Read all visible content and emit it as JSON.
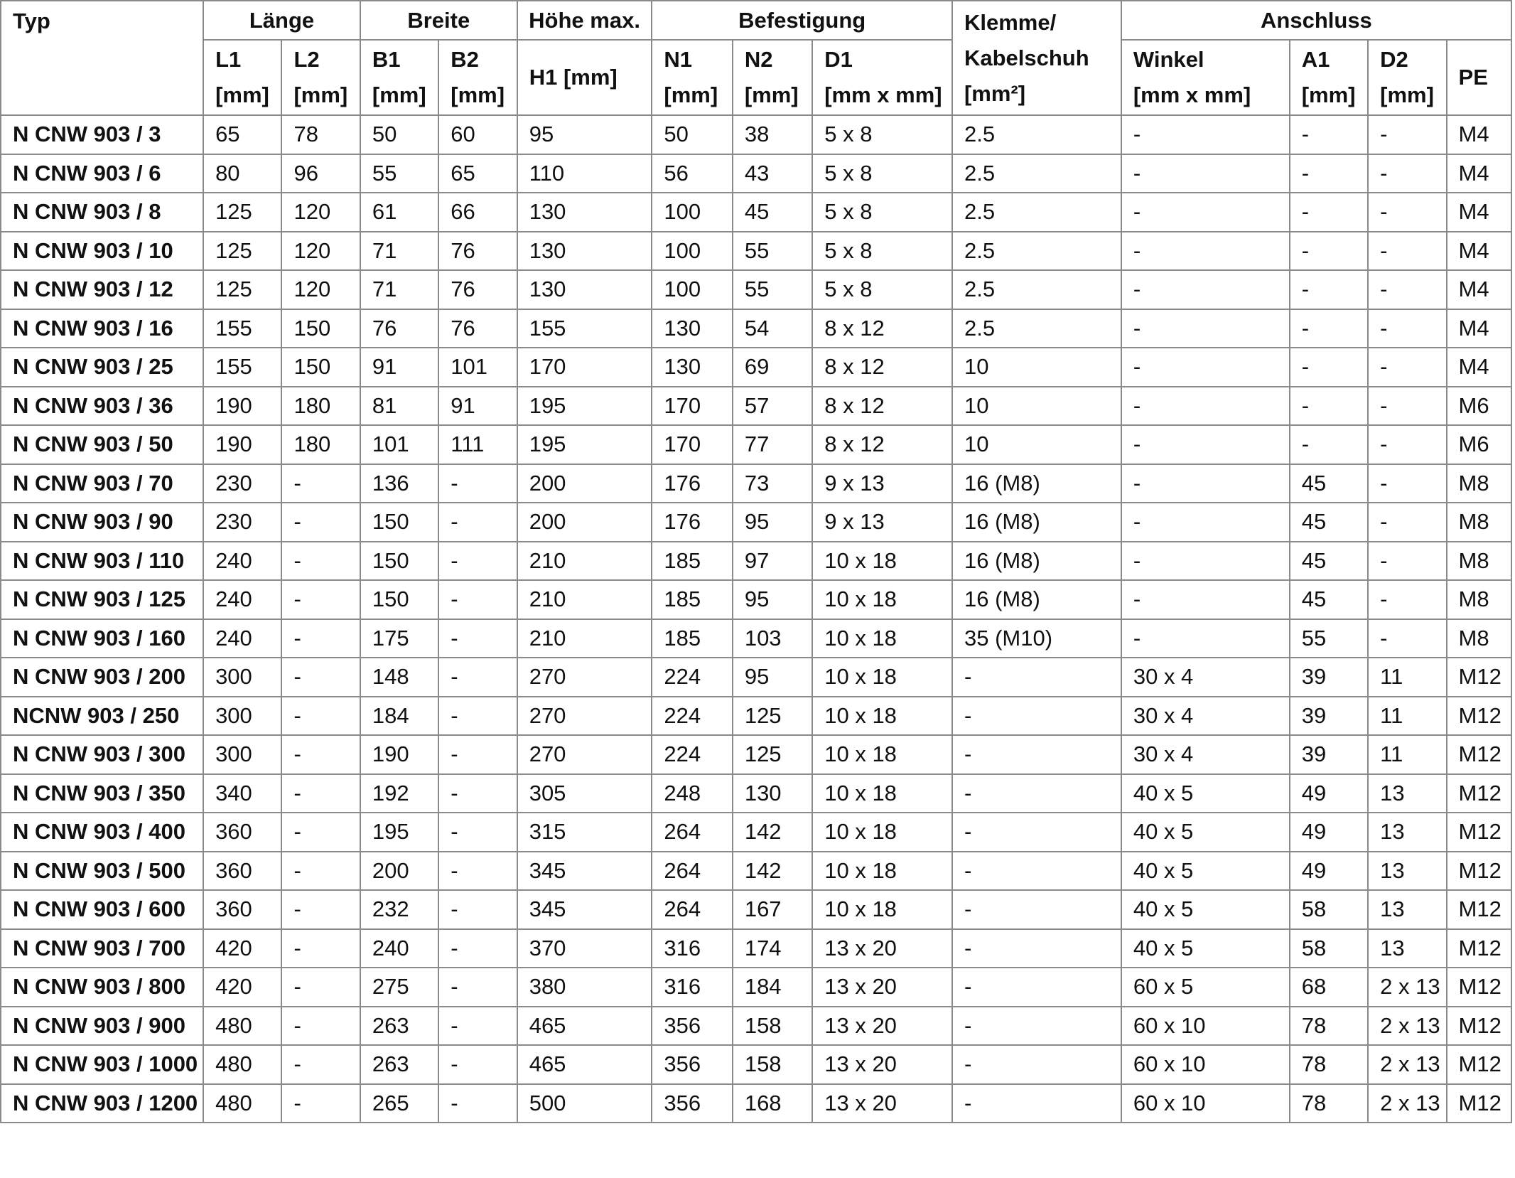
{
  "header": {
    "group_row": {
      "typ": "Typ",
      "laenge": "Länge",
      "breite": "Breite",
      "hoehe": "Höhe max.",
      "befestigung": "Befestigung",
      "klemme_line1": "Klemme/",
      "klemme_line2": "Kabelschuh",
      "klemme_line3": "[mm²]",
      "anschluss": "Anschluss"
    },
    "sub_row": {
      "l1": "L1",
      "l1_unit": "[mm]",
      "l2": "L2",
      "l2_unit": "[mm]",
      "b1": "B1",
      "b1_unit": "[mm]",
      "b2": "B2",
      "b2_unit": "[mm]",
      "h1": "H1 [mm]",
      "n1": "N1",
      "n1_unit": "[mm]",
      "n2": "N2",
      "n2_unit": "[mm]",
      "d1": "D1",
      "d1_unit": "[mm x mm]",
      "winkel": "Winkel",
      "winkel_unit": "[mm x mm]",
      "a1": "A1",
      "a1_unit": "[mm]",
      "d2": "D2",
      "d2_unit": "[mm]",
      "pe": "PE"
    }
  },
  "rows": [
    [
      "N CNW 903 / 3",
      "65",
      "78",
      "50",
      "60",
      "95",
      "50",
      "38",
      "5 x 8",
      "2.5",
      "-",
      "-",
      "-",
      "M4"
    ],
    [
      "N CNW 903 / 6",
      "80",
      "96",
      "55",
      "65",
      "110",
      "56",
      "43",
      "5 x 8",
      "2.5",
      "-",
      "-",
      "-",
      "M4"
    ],
    [
      "N CNW 903 / 8",
      "125",
      "120",
      "61",
      "66",
      "130",
      "100",
      "45",
      "5 x 8",
      "2.5",
      "-",
      "-",
      "-",
      "M4"
    ],
    [
      "N CNW 903 / 10",
      "125",
      "120",
      "71",
      "76",
      "130",
      "100",
      "55",
      "5 x 8",
      "2.5",
      "-",
      "-",
      "-",
      "M4"
    ],
    [
      "N CNW 903 / 12",
      "125",
      "120",
      "71",
      "76",
      "130",
      "100",
      "55",
      "5 x 8",
      "2.5",
      "-",
      "-",
      "-",
      "M4"
    ],
    [
      "N CNW 903 / 16",
      "155",
      "150",
      "76",
      "76",
      "155",
      "130",
      "54",
      "8 x 12",
      "2.5",
      "-",
      "-",
      "-",
      "M4"
    ],
    [
      "N CNW 903 / 25",
      "155",
      "150",
      "91",
      "101",
      "170",
      "130",
      "69",
      "8 x 12",
      "10",
      "-",
      "-",
      "-",
      "M4"
    ],
    [
      "N CNW 903 / 36",
      "190",
      "180",
      "81",
      "91",
      "195",
      "170",
      "57",
      "8 x 12",
      "10",
      "-",
      "-",
      "-",
      "M6"
    ],
    [
      "N CNW 903 / 50",
      "190",
      "180",
      "101",
      "111",
      "195",
      "170",
      "77",
      "8 x 12",
      "10",
      "-",
      "-",
      "-",
      "M6"
    ],
    [
      "N CNW 903 / 70",
      "230",
      "-",
      "136",
      "-",
      "200",
      "176",
      "73",
      "9 x 13",
      "16 (M8)",
      "-",
      "45",
      "-",
      "M8"
    ],
    [
      "N CNW 903 / 90",
      "230",
      "-",
      "150",
      "-",
      "200",
      "176",
      "95",
      "9 x 13",
      "16 (M8)",
      "-",
      "45",
      "-",
      "M8"
    ],
    [
      "N CNW 903 / 110",
      "240",
      "-",
      "150",
      "-",
      "210",
      "185",
      "97",
      "10 x 18",
      "16 (M8)",
      "-",
      "45",
      "-",
      "M8"
    ],
    [
      "N CNW 903 / 125",
      "240",
      "-",
      "150",
      "-",
      "210",
      "185",
      "95",
      "10 x 18",
      "16 (M8)",
      "-",
      "45",
      "-",
      "M8"
    ],
    [
      "N CNW 903 / 160",
      "240",
      "-",
      "175",
      "-",
      "210",
      "185",
      "103",
      "10 x 18",
      "35 (M10)",
      "-",
      "55",
      "-",
      "M8"
    ],
    [
      "N CNW 903 / 200",
      "300",
      "-",
      "148",
      "-",
      "270",
      "224",
      "95",
      "10 x 18",
      "-",
      "30 x 4",
      "39",
      "11",
      "M12"
    ],
    [
      "NCNW 903 / 250",
      "300",
      "-",
      "184",
      "-",
      "270",
      "224",
      "125",
      "10 x 18",
      "-",
      "30 x 4",
      "39",
      "11",
      "M12"
    ],
    [
      "N CNW 903 / 300",
      "300",
      "-",
      "190",
      "-",
      "270",
      "224",
      "125",
      "10 x 18",
      "-",
      "30 x 4",
      "39",
      "11",
      "M12"
    ],
    [
      "N CNW 903 / 350",
      "340",
      "-",
      "192",
      "-",
      "305",
      "248",
      "130",
      "10 x 18",
      "-",
      "40 x 5",
      "49",
      "13",
      "M12"
    ],
    [
      "N CNW 903 / 400",
      "360",
      "-",
      "195",
      "-",
      "315",
      "264",
      "142",
      "10 x 18",
      "-",
      "40 x 5",
      "49",
      "13",
      "M12"
    ],
    [
      "N CNW 903 / 500",
      "360",
      "-",
      "200",
      "-",
      "345",
      "264",
      "142",
      "10 x 18",
      "-",
      "40 x 5",
      "49",
      "13",
      "M12"
    ],
    [
      "N CNW 903 / 600",
      "360",
      "-",
      "232",
      "-",
      "345",
      "264",
      "167",
      "10 x 18",
      "-",
      "40 x 5",
      "58",
      "13",
      "M12"
    ],
    [
      "N CNW 903 / 700",
      "420",
      "-",
      "240",
      "-",
      "370",
      "316",
      "174",
      "13 x 20",
      "-",
      "40 x 5",
      "58",
      "13",
      "M12"
    ],
    [
      "N CNW 903 / 800",
      "420",
      "-",
      "275",
      "-",
      "380",
      "316",
      "184",
      "13 x 20",
      "-",
      "60 x 5",
      "68",
      "2 x 13",
      "M12"
    ],
    [
      "N CNW 903 / 900",
      "480",
      "-",
      "263",
      "-",
      "465",
      "356",
      "158",
      "13 x 20",
      "-",
      "60 x 10",
      "78",
      "2 x 13",
      "M12"
    ],
    [
      "N CNW 903 / 1000",
      "480",
      "-",
      "263",
      "-",
      "465",
      "356",
      "158",
      "13 x 20",
      "-",
      "60 x 10",
      "78",
      "2 x 13",
      "M12"
    ],
    [
      "N CNW 903 / 1200",
      "480",
      "-",
      "265",
      "-",
      "500",
      "356",
      "168",
      "13 x 20",
      "-",
      "60 x 10",
      "78",
      "2 x 13",
      "M12"
    ]
  ]
}
